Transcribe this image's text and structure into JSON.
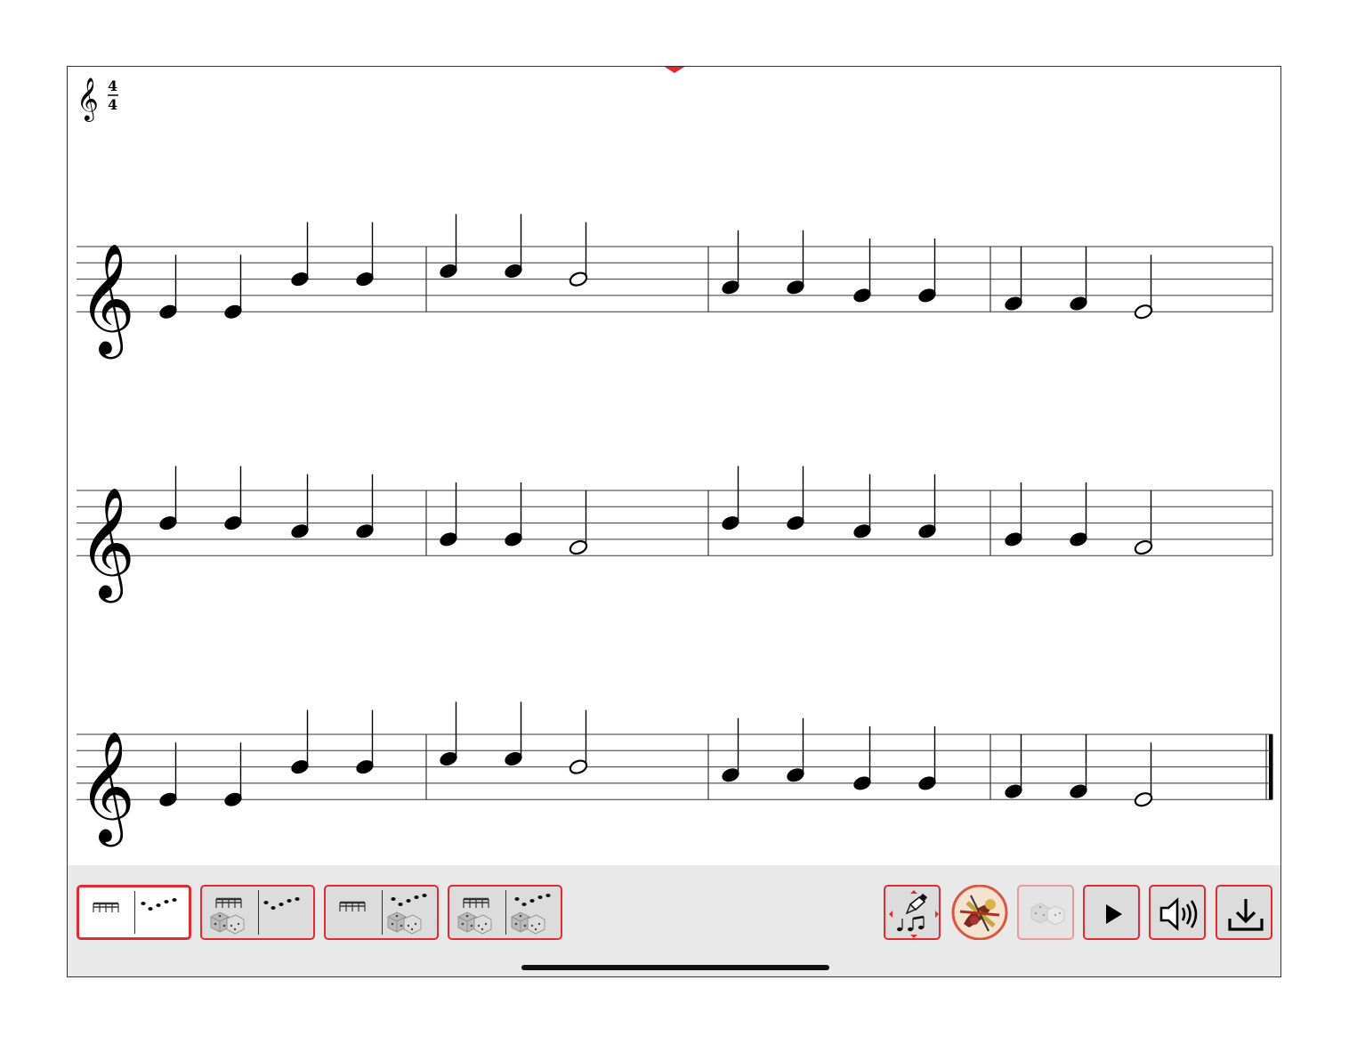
{
  "time_signature": {
    "top": "4",
    "bottom": "4"
  },
  "header_clef": "treble-clef-icon",
  "score": {
    "clef": "treble",
    "systems": [
      {
        "measures": [
          [
            {
              "step": -2,
              "dur": "q"
            },
            {
              "step": -2,
              "dur": "q"
            },
            {
              "step": 2,
              "dur": "q"
            },
            {
              "step": 2,
              "dur": "q"
            }
          ],
          [
            {
              "step": 3,
              "dur": "q"
            },
            {
              "step": 3,
              "dur": "q"
            },
            {
              "step": 2,
              "dur": "h"
            }
          ],
          [
            {
              "step": 1,
              "dur": "q"
            },
            {
              "step": 1,
              "dur": "q"
            },
            {
              "step": 0,
              "dur": "q"
            },
            {
              "step": 0,
              "dur": "q"
            }
          ],
          [
            {
              "step": -1,
              "dur": "q"
            },
            {
              "step": -1,
              "dur": "q"
            },
            {
              "step": -2,
              "dur": "h"
            }
          ]
        ],
        "final_barline": false
      },
      {
        "measures": [
          [
            {
              "step": 2,
              "dur": "q"
            },
            {
              "step": 2,
              "dur": "q"
            },
            {
              "step": 1,
              "dur": "q"
            },
            {
              "step": 1,
              "dur": "q"
            }
          ],
          [
            {
              "step": 0,
              "dur": "q"
            },
            {
              "step": 0,
              "dur": "q"
            },
            {
              "step": -1,
              "dur": "h"
            }
          ],
          [
            {
              "step": 2,
              "dur": "q"
            },
            {
              "step": 2,
              "dur": "q"
            },
            {
              "step": 1,
              "dur": "q"
            },
            {
              "step": 1,
              "dur": "q"
            }
          ],
          [
            {
              "step": 0,
              "dur": "q"
            },
            {
              "step": 0,
              "dur": "q"
            },
            {
              "step": -1,
              "dur": "h"
            }
          ]
        ],
        "final_barline": false
      },
      {
        "measures": [
          [
            {
              "step": -2,
              "dur": "q"
            },
            {
              "step": -2,
              "dur": "q"
            },
            {
              "step": 2,
              "dur": "q"
            },
            {
              "step": 2,
              "dur": "q"
            }
          ],
          [
            {
              "step": 3,
              "dur": "q"
            },
            {
              "step": 3,
              "dur": "q"
            },
            {
              "step": 2,
              "dur": "h"
            }
          ],
          [
            {
              "step": 1,
              "dur": "q"
            },
            {
              "step": 1,
              "dur": "q"
            },
            {
              "step": 0,
              "dur": "q"
            },
            {
              "step": 0,
              "dur": "q"
            }
          ],
          [
            {
              "step": -1,
              "dur": "q"
            },
            {
              "step": -1,
              "dur": "q"
            },
            {
              "step": -2,
              "dur": "h"
            }
          ]
        ],
        "final_barline": true
      }
    ]
  },
  "toolbar": {
    "mode_buttons": [
      {
        "name": "mode-rhythm-melody",
        "rhythm_dice": false,
        "melody_dice": false,
        "selected": true
      },
      {
        "name": "mode-random-rhythm",
        "rhythm_dice": true,
        "melody_dice": false,
        "selected": false
      },
      {
        "name": "mode-random-melody",
        "rhythm_dice": false,
        "melody_dice": true,
        "selected": false
      },
      {
        "name": "mode-random-both",
        "rhythm_dice": true,
        "melody_dice": true,
        "selected": false
      }
    ],
    "action_buttons": [
      {
        "name": "compose-button",
        "icon": "pen-notes-icon",
        "disabled": false
      },
      {
        "name": "instrument-button",
        "icon": "instruments-icon",
        "disabled": false
      },
      {
        "name": "dice-button",
        "icon": "dice-icon",
        "disabled": true
      },
      {
        "name": "play-button",
        "icon": "play-icon",
        "disabled": false
      },
      {
        "name": "sound-button",
        "icon": "speaker-icon",
        "disabled": false
      },
      {
        "name": "download-button",
        "icon": "download-icon",
        "disabled": false
      }
    ],
    "accent_color": "#e12b30"
  }
}
